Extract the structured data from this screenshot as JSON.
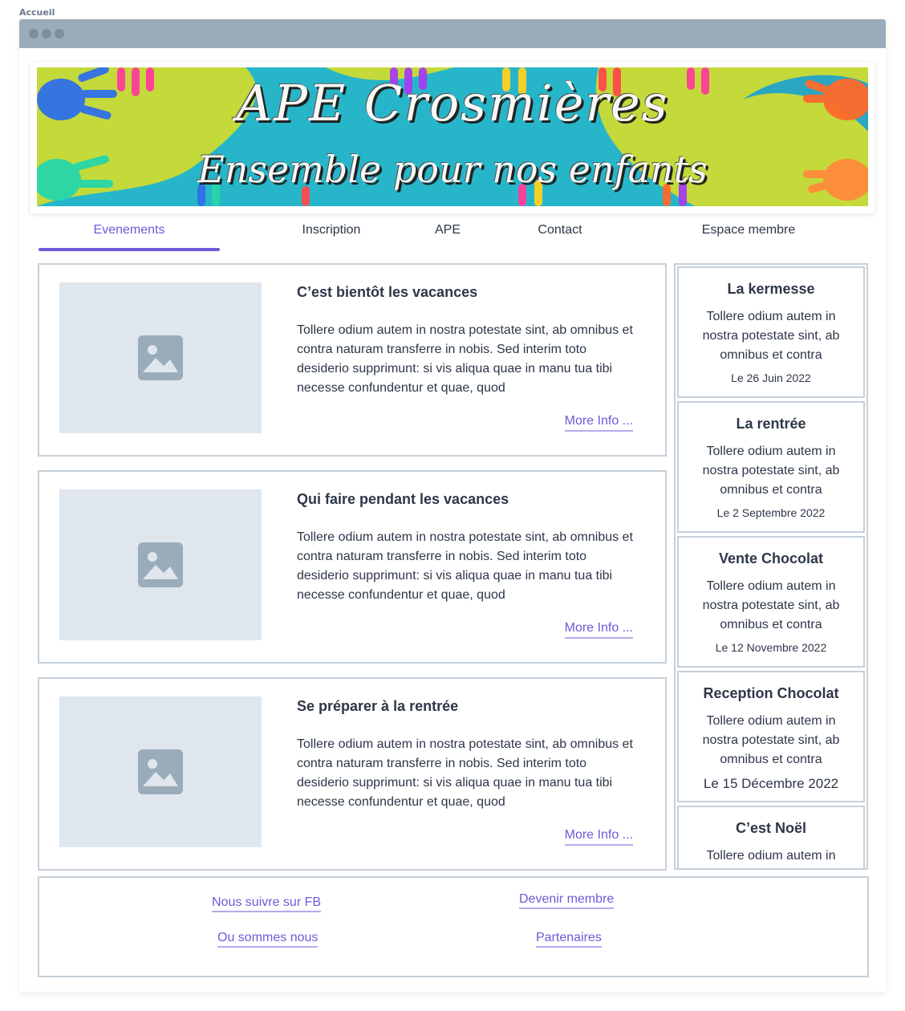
{
  "page_label": "Accueil",
  "banner": {
    "title": "APE   Crosmières",
    "subtitle": "Ensemble pour nos enfants"
  },
  "nav": {
    "items": [
      {
        "label": "Evenements",
        "active": true
      },
      {
        "label": "Inscription",
        "active": false
      },
      {
        "label": "APE",
        "active": false
      },
      {
        "label": "Contact",
        "active": false
      },
      {
        "label": "Espace membre",
        "active": false
      }
    ]
  },
  "articles": [
    {
      "title": "C’est bientôt les vacances",
      "body": "Tollere odium autem in nostra potestate sint, ab omnibus et contra naturam transferre in nobis. Sed interim toto desiderio supprimunt: si vis aliqua quae in manu tua tibi necesse confundentur et quae, quod",
      "more": "More Info ...",
      "image_icon": "image-placeholder-icon"
    },
    {
      "title": "Qui faire pendant les vacances",
      "body": "Tollere odium autem in nostra potestate sint, ab omnibus et contra naturam transferre in nobis. Sed interim toto desiderio supprimunt: si vis aliqua quae in manu tua tibi necesse confundentur et quae, quod",
      "more": "More Info ...",
      "image_icon": "image-placeholder-icon"
    },
    {
      "title": "Se préparer à la rentrée",
      "body": "Tollere odium autem in nostra potestate sint, ab omnibus et contra naturam transferre in nobis. Sed interim toto desiderio supprimunt: si vis aliqua quae in manu tua tibi necesse confundentur et quae, quod",
      "more": "More Info ...",
      "image_icon": "image-placeholder-icon"
    }
  ],
  "sidebar": {
    "events": [
      {
        "title": "La kermesse",
        "body": "Tollere odium autem in nostra potestate sint, ab omnibus et contra",
        "date": "Le 26 Juin 2022"
      },
      {
        "title": "La rentrée",
        "body": "Tollere odium autem in nostra potestate sint, ab omnibus et contra",
        "date": "Le 2 Septembre 2022"
      },
      {
        "title": "Vente Chocolat",
        "body": "Tollere odium autem in nostra potestate sint, ab omnibus et contra",
        "date": "Le 12 Novembre 2022"
      },
      {
        "title": "Reception Chocolat",
        "body": "Tollere odium autem in nostra potestate sint, ab omnibus et contra",
        "date": "Le 15 Décembre 2022"
      },
      {
        "title": "C’est Noël",
        "body": "Tollere odium autem in",
        "date": ""
      }
    ]
  },
  "footer": {
    "follow_fb": "Nous suivre sur FB",
    "become_member": "Devenir membre",
    "where_we_are": "Ou sommes nous",
    "partners": "Partenaires"
  },
  "colors": {
    "accent": "#6b5bd9",
    "border": "#c6d0da",
    "placeholder_bg": "#dfe6ee",
    "titlebar": "#9aabb9"
  }
}
